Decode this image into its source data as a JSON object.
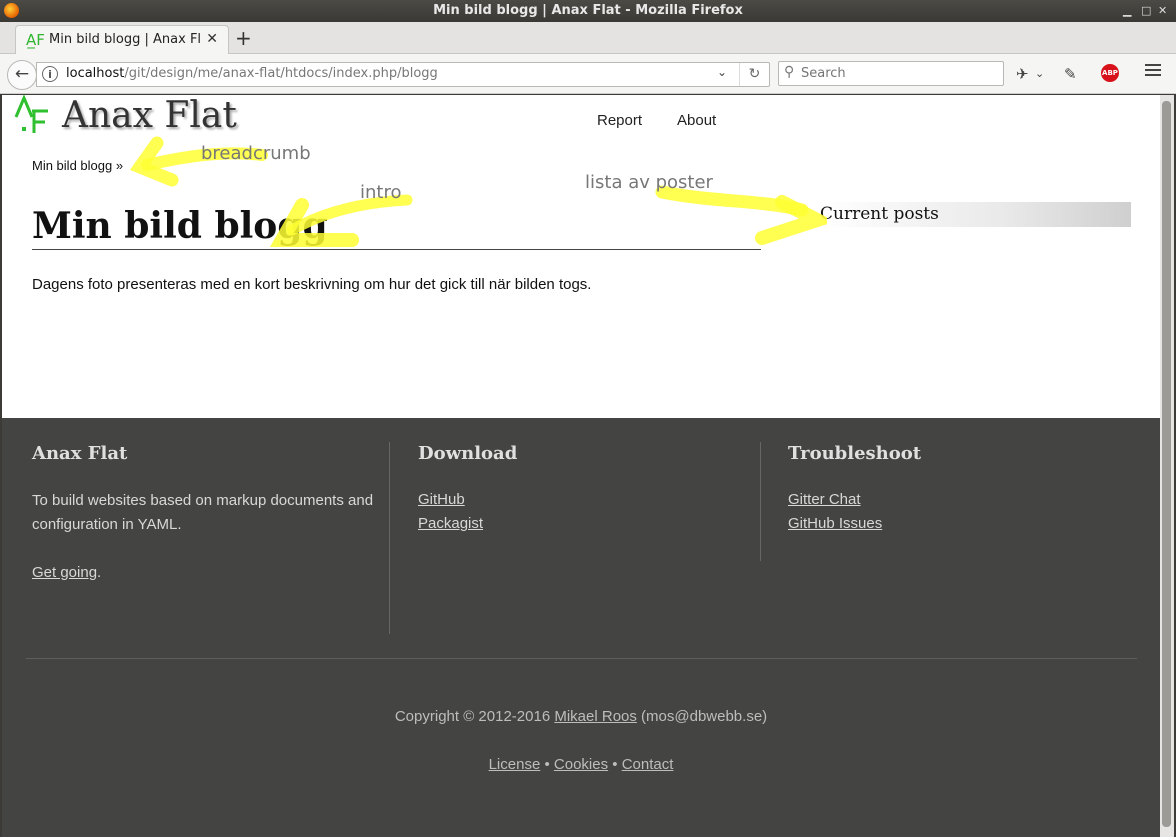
{
  "window": {
    "title": "Min bild blogg | Anax Flat - Mozilla Firefox"
  },
  "browser": {
    "tab_title": "Min bild blogg | Anax Flat",
    "url_host": "localhost",
    "url_path": "/git/design/me/anax-flat/htdocs/index.php/blogg",
    "search_placeholder": "Search",
    "abp_label": "ABP"
  },
  "site": {
    "logo_text": "Anax Flat",
    "nav": [
      {
        "label": "Report"
      },
      {
        "label": "About"
      }
    ],
    "breadcrumb": "Min bild blogg »",
    "page_title": "Min bild blogg",
    "intro": "Dagens foto presenteras med en kort beskrivning om hur det gick till när bilden togs.",
    "sidebar_heading": "Current posts"
  },
  "annotations": {
    "breadcrumb": "breadcrumb",
    "intro": "intro",
    "posts": "lista av poster",
    "highlight_color": "#ffff33"
  },
  "footer": {
    "col1": {
      "heading": "Anax Flat",
      "text": "To build websites based on markup documents and configuration in YAML.",
      "link": "Get going",
      "link_suffix": "."
    },
    "col2": {
      "heading": "Download",
      "links": [
        {
          "label": "GitHub"
        },
        {
          "label": "Packagist"
        }
      ]
    },
    "col3": {
      "heading": "Troubleshoot",
      "links": [
        {
          "label": "Gitter Chat"
        },
        {
          "label": "GitHub Issues"
        }
      ]
    },
    "copyright_prefix": "Copyright © 2012-2016",
    "copyright_name": "Mikael Roos",
    "copyright_email": "(mos@dbwebb.se)",
    "legal": [
      {
        "label": "License"
      },
      {
        "label": "Cookies"
      },
      {
        "label": "Contact"
      }
    ],
    "separator": "•"
  }
}
